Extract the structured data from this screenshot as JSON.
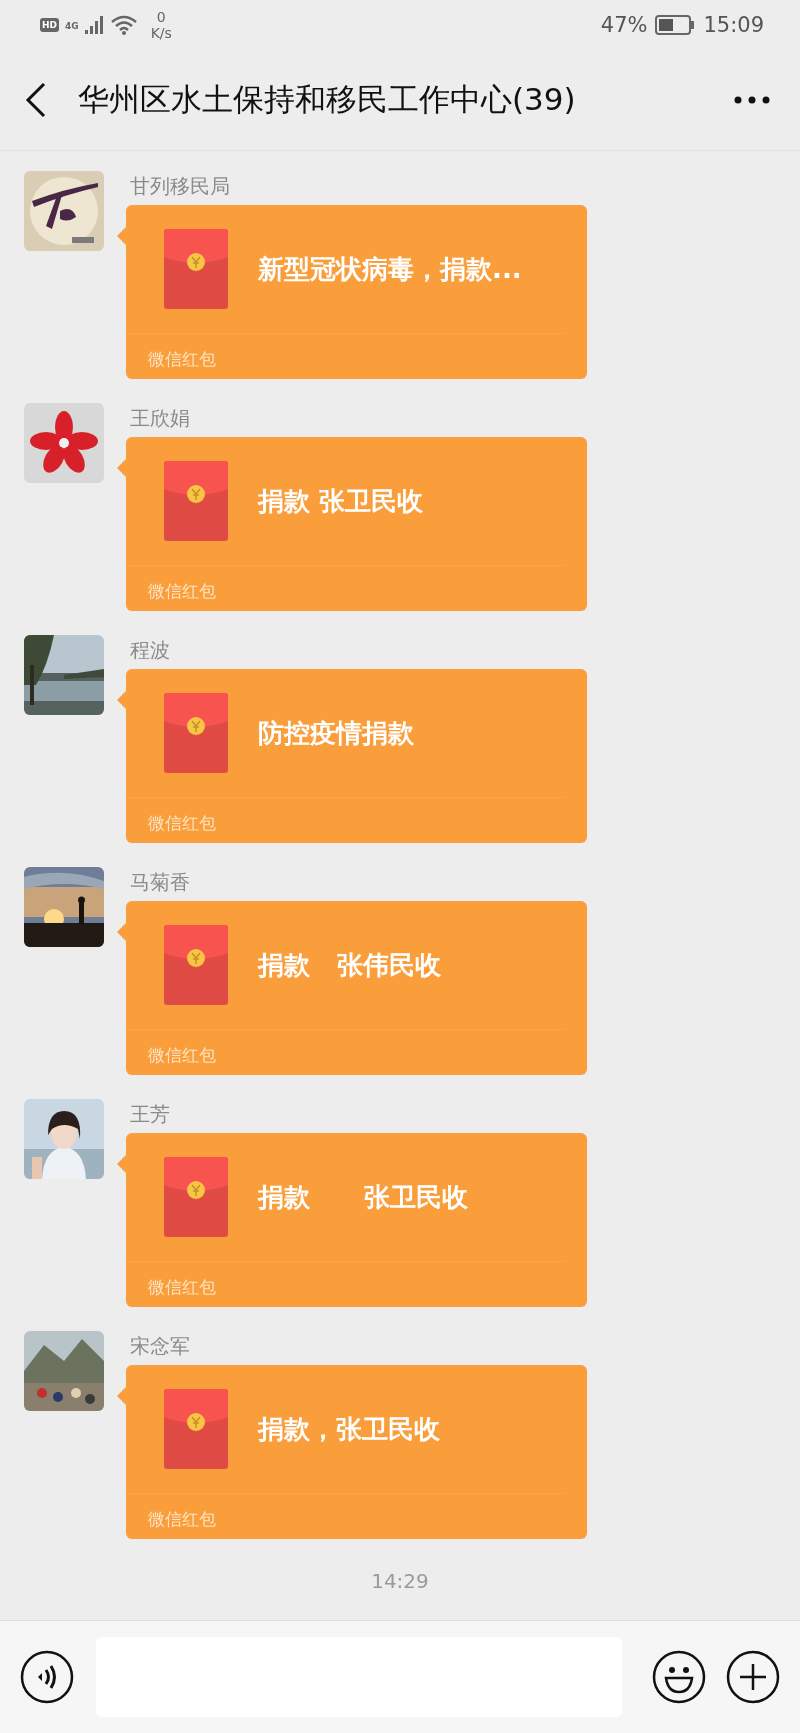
{
  "status_bar": {
    "hd": "HD",
    "network": "4G",
    "speed_value": "0",
    "speed_unit": "K/s",
    "battery_percent": "47%",
    "time": "15:09"
  },
  "header": {
    "title": "华州区水土保持和移民工作中心(39)"
  },
  "messages": [
    {
      "sender": "甘列移民局",
      "title": "新型冠状病毒，捐款...",
      "footer": "微信红包"
    },
    {
      "sender": "王欣娟",
      "title": "捐款 张卫民收",
      "footer": "微信红包"
    },
    {
      "sender": "程波",
      "title": "防控疫情捐款",
      "footer": "微信红包"
    },
    {
      "sender": "马菊香",
      "title": "捐款   张伟民收",
      "footer": "微信红包"
    },
    {
      "sender": "王芳",
      "title": "捐款      张卫民收",
      "footer": "微信红包"
    },
    {
      "sender": "宋念军",
      "title": "捐款，张卫民收",
      "footer": "微信红包"
    }
  ],
  "timestamp": "14:29"
}
